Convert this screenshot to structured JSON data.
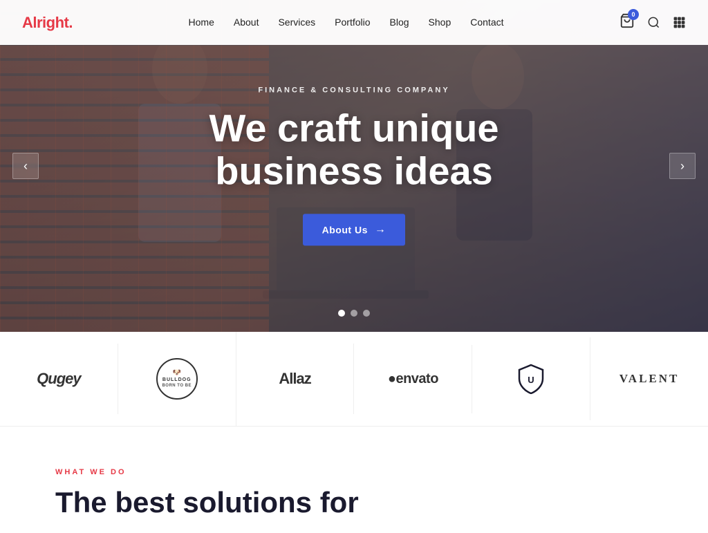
{
  "brand": {
    "name": "Alright",
    "accent": "."
  },
  "nav": {
    "links": [
      {
        "label": "Home",
        "href": "#"
      },
      {
        "label": "About",
        "href": "#"
      },
      {
        "label": "Services",
        "href": "#"
      },
      {
        "label": "Portfolio",
        "href": "#"
      },
      {
        "label": "Blog",
        "href": "#"
      },
      {
        "label": "Shop",
        "href": "#"
      },
      {
        "label": "Contact",
        "href": "#"
      }
    ],
    "cart_count": "0"
  },
  "hero": {
    "subtitle": "Finance & Consulting Company",
    "title_line1": "We craft unique",
    "title_line2": "business ideas",
    "cta_label": "About Us",
    "prev_label": "‹",
    "next_label": "›",
    "dots": [
      {
        "active": true
      },
      {
        "active": false
      },
      {
        "active": false
      }
    ]
  },
  "logos": [
    {
      "type": "text",
      "text": "Qugey",
      "style": "normal"
    },
    {
      "type": "circle",
      "text": "BULLDOG\nBORN TO BE"
    },
    {
      "type": "text",
      "text": "Allaz",
      "style": "normal"
    },
    {
      "type": "text",
      "text": "●envato",
      "style": "normal"
    },
    {
      "type": "icon",
      "text": "⊍",
      "style": "icon"
    },
    {
      "type": "text",
      "text": "VALENT",
      "style": "serif"
    }
  ],
  "what_we_do": {
    "tag": "What We Do",
    "title_line1": "The best solutions for"
  },
  "colors": {
    "accent": "#e63946",
    "primary": "#3b5bdb",
    "dark": "#1a1a2e"
  }
}
